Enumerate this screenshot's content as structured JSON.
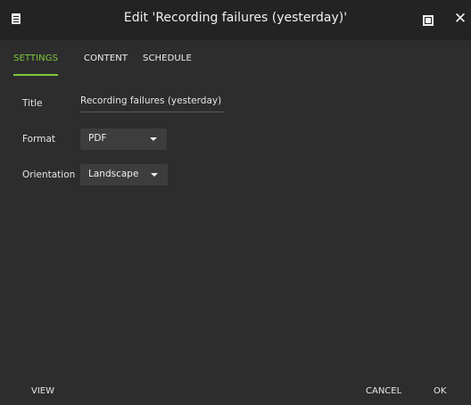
{
  "window": {
    "title": "Edit 'Recording failures (yesterday)'"
  },
  "tabs": [
    {
      "label": "SETTINGS",
      "active": true
    },
    {
      "label": "CONTENT",
      "active": false
    },
    {
      "label": "SCHEDULE",
      "active": false
    }
  ],
  "settings": {
    "title_label": "Title",
    "title_value": "Recording failures (yesterday)",
    "format_label": "Format",
    "format_value": "PDF",
    "orientation_label": "Orientation",
    "orientation_value": "Landscape"
  },
  "footer": {
    "view_label": "VIEW",
    "cancel_label": "CANCEL",
    "ok_label": "OK"
  },
  "colors": {
    "accent": "#7cc83e",
    "background": "#2d2d2d",
    "titlebar": "#232323",
    "select_background": "#3d3d3d"
  },
  "icons": [
    "app-menu-icon",
    "maximize-icon",
    "close-icon",
    "chevron-down-icon"
  ]
}
